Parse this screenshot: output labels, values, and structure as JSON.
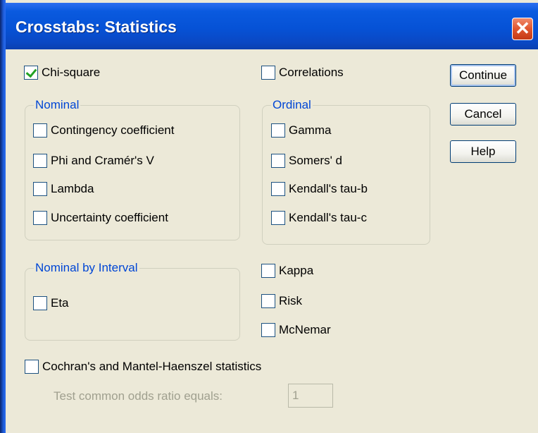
{
  "window": {
    "title": "Crosstabs: Statistics",
    "close_symbol": "✕"
  },
  "checks": {
    "chi_square": {
      "label": "Chi-square",
      "checked": true
    },
    "correlations": {
      "label": "Correlations",
      "checked": false
    },
    "cochran": {
      "label": "Cochran's and Mantel-Haenszel statistics",
      "checked": false
    }
  },
  "nominal": {
    "legend": "Nominal",
    "items": [
      "Contingency coefficient",
      "Phi and Cramér's V",
      "Lambda",
      "Uncertainty coefficient"
    ]
  },
  "ordinal": {
    "legend": "Ordinal",
    "items": [
      "Gamma",
      "Somers' d",
      "Kendall's tau-b",
      "Kendall's tau-c"
    ]
  },
  "nominal_by_interval": {
    "legend": "Nominal by Interval",
    "items": [
      "Eta"
    ]
  },
  "other": {
    "items": [
      "Kappa",
      "Risk",
      "McNemar"
    ]
  },
  "buttons": {
    "continue": "Continue",
    "cancel": "Cancel",
    "help": "Help"
  },
  "odds": {
    "label": "Test common odds ratio equals:",
    "value": "1"
  },
  "colors": {
    "title_bar": "#0652d6",
    "legend_text": "#0046d5",
    "close": "#e0552e"
  }
}
